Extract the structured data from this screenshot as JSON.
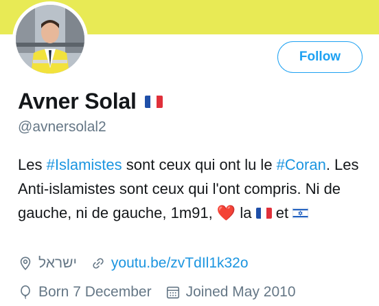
{
  "colors": {
    "banner": "#e8ea55",
    "accent": "#1da1f2",
    "link": "#1b95e0",
    "muted": "#657786",
    "heart": "#e0245e"
  },
  "profile": {
    "name": "Avner Solal",
    "handle": "@avnersolal2",
    "follow_label": "Follow"
  },
  "bio": {
    "t1": "Les ",
    "tag1": "#Islamistes",
    "t2": " sont ceux qui ont lu le ",
    "tag2": "#Coran",
    "t3": ". Les Anti-islamistes sont ceux qui l'ont compris. Ni de gauche, ni de gauche, 1m91, ",
    "heart": "❤️",
    "t4": " la ",
    "t5": " et "
  },
  "meta": {
    "location": "ישראל",
    "website": "youtu.be/zvTdIl1k32o",
    "born": "Born 7 December",
    "joined": "Joined May 2010"
  },
  "icons": [
    "location-pin-icon",
    "link-icon",
    "balloon-icon",
    "calendar-icon",
    "france-flag-icon",
    "israel-flag-icon",
    "heart-icon"
  ]
}
